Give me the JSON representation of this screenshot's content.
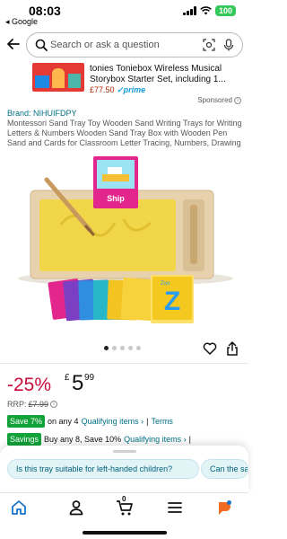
{
  "status_bar": {
    "time": "08:03",
    "back_app": "◂ Google",
    "battery": "100"
  },
  "search": {
    "placeholder": "Search or ask a question"
  },
  "ad": {
    "title": "tonies Toniebox Wireless Musical Storybox Starter Set, including 1...",
    "price": "£77.50",
    "prime": "prime"
  },
  "sponsored_label": "Sponsored",
  "brand": "Brand: NIHUIFDPY",
  "product_title": "Montessori Sand Tray Toy Wooden Sand Writing Trays for Writing Letters & Numbers Wooden Sand Tray Box with Wooden Pen Sand and Cards for Classroom Letter Tracing, Numbers, Drawing",
  "image": {
    "card_word": "Ship",
    "card_letter": "Z",
    "card_word_2": "Zoo"
  },
  "carousel": {
    "count": 5,
    "active": 1
  },
  "price": {
    "discount": "-25%",
    "currency": "£",
    "whole": "5",
    "fraction": "99",
    "rrp_label": "RRP:",
    "rrp_value": "£7.99"
  },
  "offers": {
    "save_badge": "Save 7%",
    "save_text": "on any 4",
    "qualifying": "Qualifying items ›",
    "sep": "|",
    "terms": "Terms",
    "savings_badge": "Savings",
    "savings_text": "Buy any 8, Save 10%",
    "qualifying_2": "Qualifying items ›",
    "sep_2": "|"
  },
  "questions": [
    "Is this tray suitable for left-handed children?",
    "Can the sand"
  ],
  "nav": {
    "cart_count": "0"
  },
  "colors": {
    "accent_teal": "#007185",
    "discount_red": "#cc0c39",
    "save_green": "#12a23a",
    "prime_blue": "#1399d6"
  }
}
